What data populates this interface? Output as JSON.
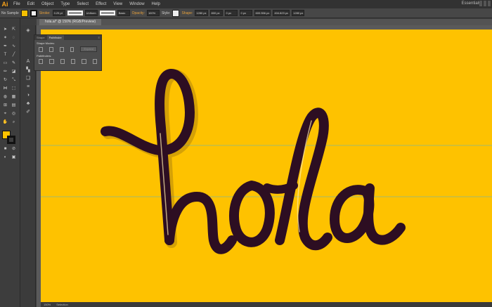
{
  "app": {
    "logo": "Ai"
  },
  "menubar": {
    "items": [
      "File",
      "Edit",
      "Object",
      "Type",
      "Select",
      "Effect",
      "View",
      "Window",
      "Help"
    ],
    "workspace": "Essentials"
  },
  "control_bar": {
    "selection_label": "No Sample",
    "stroke_label": "Stroke:",
    "stroke_weight": "0.25 pt",
    "brush_profile": "Uniform",
    "brush_definition": "Basic",
    "opacity_label": "Opacity:",
    "opacity_value": "100%",
    "style_label": "Style:",
    "shape_label": "Shape:",
    "w_value": "1280 px",
    "h_value": "800 px",
    "x_value": "0 px",
    "y_value": "0 px",
    "ref_x_value": "600.556 px",
    "ref_y_value": "404.823 px",
    "extra_value": "1280 px"
  },
  "document": {
    "tab_title": "hola.ai* @ 150% (RGB/Preview)"
  },
  "panel": {
    "tabs": [
      "Shape",
      "Pathfinder"
    ],
    "shape_modes_label": "Shape Modes:",
    "expand_label": "Expand",
    "pathfinders_label": "Pathfinders:"
  },
  "artwork": {
    "lettering": "hola",
    "colors": {
      "background": "#fec200",
      "letter_fill": "#2d0e22",
      "highlight": "#fde9a9",
      "guide": "#48b3e0"
    }
  },
  "status": {
    "zoom": "150%",
    "tool": "Selection"
  },
  "colors": {
    "ui_dark": "#323232",
    "ui_mid": "#474747",
    "accent": "#f7a21b"
  }
}
